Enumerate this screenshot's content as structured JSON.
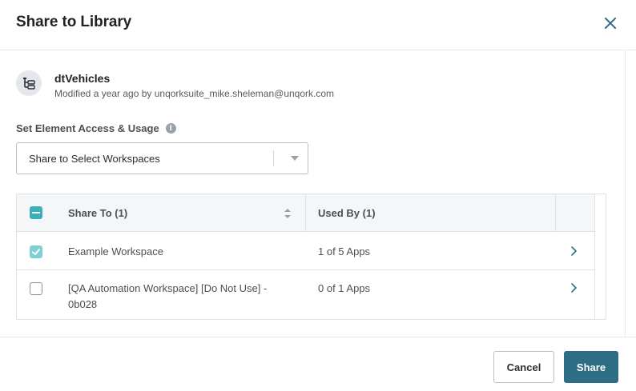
{
  "modal": {
    "title": "Share to Library"
  },
  "element": {
    "name": "dtVehicles",
    "meta": "Modified a year ago by unqorksuite_mike.sheleman@unqork.com"
  },
  "access": {
    "label": "Set Element Access & Usage",
    "selected": "Share to Select Workspaces"
  },
  "table": {
    "headers": {
      "share_to": "Share To (1)",
      "used_by": "Used By (1)"
    },
    "rows": [
      {
        "name": "Example Workspace",
        "used_by": "1 of 5 Apps",
        "checked": true
      },
      {
        "name_line1": "[QA Automation Workspace] [Do Not Use] -",
        "name_line2": "0b028",
        "used_by": "0 of 1 Apps",
        "checked": false
      }
    ]
  },
  "footer": {
    "cancel_label": "Cancel",
    "share_label": "Share"
  },
  "colors": {
    "accent": "#3ab0ba",
    "primary_button": "#2e6e85"
  },
  "icons": {
    "close": "close-icon",
    "element": "tree-structure-icon",
    "info": "info-icon",
    "sort": "sort-icon",
    "row_open": "chevron-right-icon"
  }
}
